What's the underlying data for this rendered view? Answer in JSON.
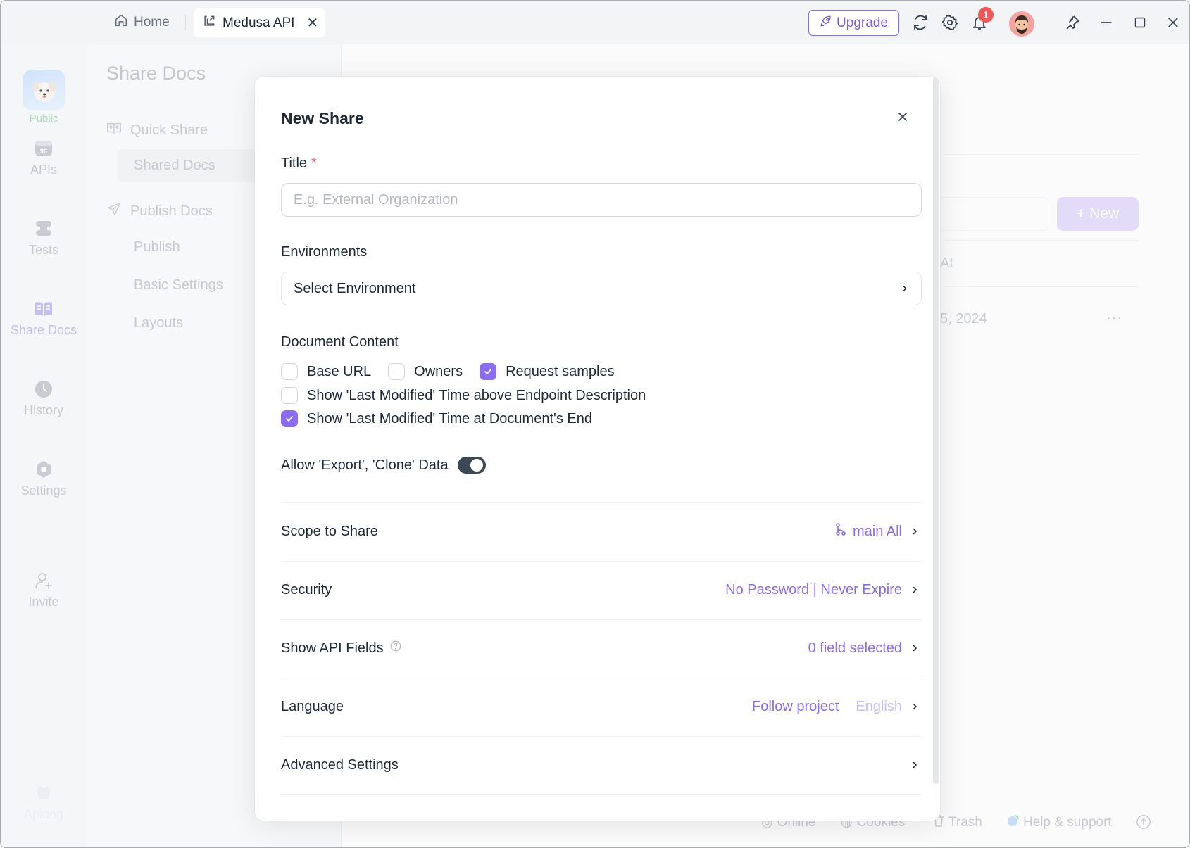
{
  "titlebar": {
    "tabs": [
      {
        "label": "Home",
        "icon": "home-icon",
        "active": false
      },
      {
        "label": "Medusa API",
        "icon": "external-link-icon",
        "active": true
      }
    ],
    "upgrade_label": "Upgrade",
    "notification_count": "1"
  },
  "sidebar": {
    "project_badge": "Public",
    "items": [
      {
        "label": "APIs",
        "icon": "api-icon"
      },
      {
        "label": "Tests",
        "icon": "tests-icon"
      },
      {
        "label": "Share Docs",
        "icon": "book-icon",
        "active": true
      },
      {
        "label": "History",
        "icon": "clock-icon"
      },
      {
        "label": "Settings",
        "icon": "settings-icon"
      },
      {
        "label": "Invite",
        "icon": "invite-user-icon"
      }
    ],
    "bottom_label": "Apidog"
  },
  "subbar": {
    "title": "Share Docs",
    "groups": [
      {
        "label": "Quick Share",
        "icon": "book-open-icon",
        "items": [
          "Shared Docs"
        ]
      },
      {
        "label": "Publish Docs",
        "icon": "send-icon",
        "items": [
          "Publish",
          "Basic Settings",
          "Layouts"
        ]
      }
    ],
    "active_item": "Shared Docs"
  },
  "background": {
    "new_button": "New",
    "column_header_fragment": "At",
    "row_date_fragment": "5, 2024",
    "more_label": "···"
  },
  "statusbar": {
    "items": [
      "Online",
      "Cookies",
      "Trash",
      "Help & support"
    ]
  },
  "modal": {
    "title": "New Share",
    "title_field": {
      "label": "Title",
      "required_mark": "*",
      "value": "",
      "placeholder": "E.g. External Organization"
    },
    "environments": {
      "label": "Environments",
      "value": "Select Environment"
    },
    "document_content": {
      "label": "Document Content",
      "options": [
        {
          "label": "Base URL",
          "checked": false
        },
        {
          "label": "Owners",
          "checked": false
        },
        {
          "label": "Request samples",
          "checked": true
        },
        {
          "label": "Show 'Last Modified' Time above Endpoint Description",
          "checked": false
        },
        {
          "label": "Show 'Last Modified' Time at Document's End",
          "checked": true
        }
      ]
    },
    "allow_export": {
      "label": "Allow 'Export', 'Clone' Data",
      "enabled": true
    },
    "settings": [
      {
        "label": "Scope to Share",
        "value": "main All",
        "value_icon": "branch-icon"
      },
      {
        "label": "Security",
        "value": "No Password | Never Expire"
      },
      {
        "label": "Show API Fields",
        "value": "0 field selected",
        "help_icon": true
      },
      {
        "label": "Language",
        "value": "Follow project",
        "secondary": "English"
      },
      {
        "label": "Advanced Settings",
        "value": ""
      }
    ]
  },
  "colors": {
    "accent": "#8b6cf0",
    "toggle_on": "#3e4756",
    "required": "#e0567c",
    "badge": "#f25757"
  }
}
